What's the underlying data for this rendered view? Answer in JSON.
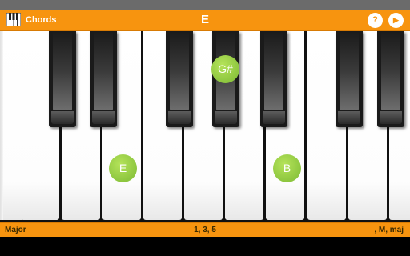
{
  "toolbar": {
    "app_icon": "piano-keys-icon",
    "title": "Chords",
    "chord_name": "E",
    "help_label": "?",
    "play_icon": "play-icon"
  },
  "keyboard": {
    "highlighted_notes": [
      {
        "name": "E"
      },
      {
        "name": "G#"
      },
      {
        "name": "B"
      }
    ],
    "colors": {
      "marker": "#8dc63f",
      "accent": "#f7940f"
    }
  },
  "info": {
    "chord_type": "Major",
    "formula": "1, 3, 5",
    "aliases": ", M, maj"
  }
}
